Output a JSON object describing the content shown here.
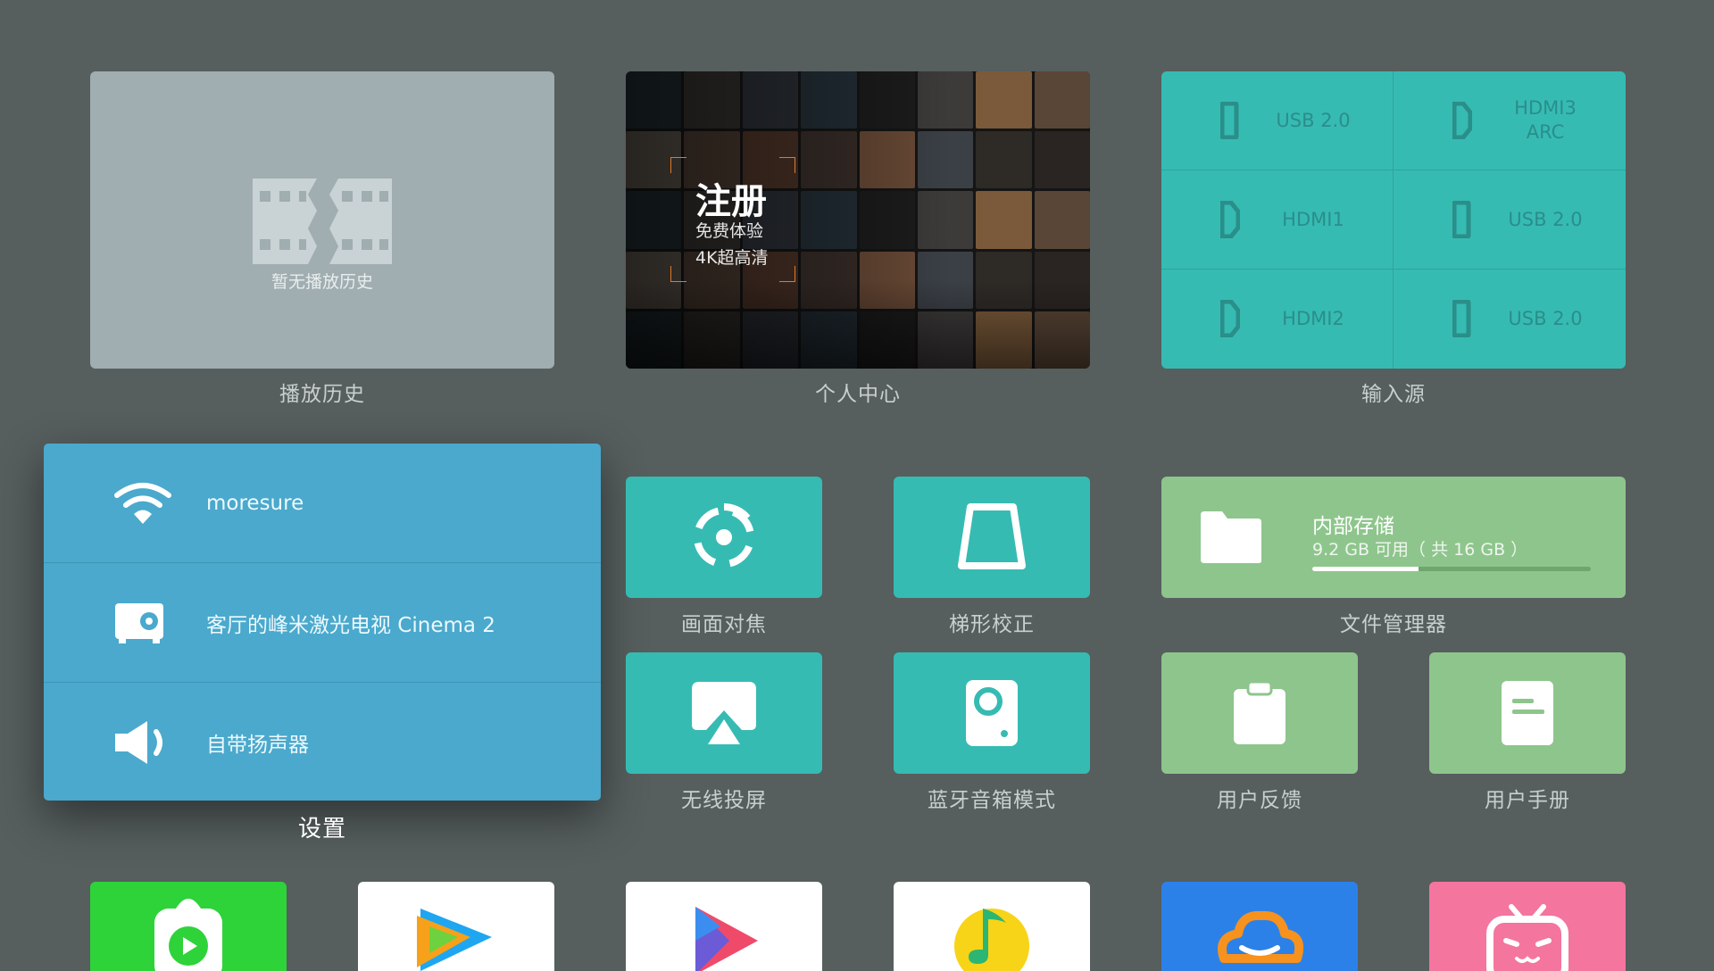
{
  "row1": {
    "history": {
      "empty_text": "暂无播放历史",
      "label": "播放历史"
    },
    "profile": {
      "title": "注册",
      "line1": "免费体验",
      "line2": "4K超高清",
      "label": "个人中心"
    },
    "inputs": {
      "label": "输入源",
      "sources": [
        {
          "name": "USB 2.0",
          "icon": "usb-port-icon"
        },
        {
          "name": "HDMI3\nARC",
          "icon": "hdmi-port-icon"
        },
        {
          "name": "HDMI1",
          "icon": "hdmi-port-icon"
        },
        {
          "name": "USB 2.0",
          "icon": "usb-port-icon"
        },
        {
          "name": "HDMI2",
          "icon": "hdmi-port-icon"
        },
        {
          "name": "USB 2.0",
          "icon": "usb-port-icon"
        }
      ]
    }
  },
  "settings": {
    "label": "设置",
    "wifi": "moresure",
    "device": "客厅的峰米激光电视 Cinema 2",
    "speaker": "自带扬声器"
  },
  "tiles": {
    "focus": "画面对焦",
    "keystone": "梯形校正",
    "storage": {
      "label": "文件管理器",
      "title": "内部存储",
      "info": "9.2 GB 可用（ 共 16 GB ）",
      "used_fraction": 0.38
    },
    "cast": "无线投屏",
    "bt_speaker": "蓝牙音箱模式",
    "feedback": "用户反馈",
    "manual": "用户手册"
  },
  "apps": [
    {
      "icon": "iqiyi-kids-icon",
      "bg": "#2ed33a"
    },
    {
      "icon": "tencent-video-icon",
      "bg": "#ffffff"
    },
    {
      "icon": "media-player-icon",
      "bg": "#ffffff"
    },
    {
      "icon": "qq-music-icon",
      "bg": "#ffffff"
    },
    {
      "icon": "cloud-karaoke-icon",
      "bg": "#2c81e8"
    },
    {
      "icon": "bilibili-icon",
      "bg": "#f4759d"
    }
  ],
  "colors": {
    "background": "#565e5e",
    "teal": "#36bbb3",
    "green": "#8ec58c",
    "settings_blue": "#4aa9cd",
    "history_gray": "#a0adb1",
    "bracket_orange": "#e07a2a"
  }
}
